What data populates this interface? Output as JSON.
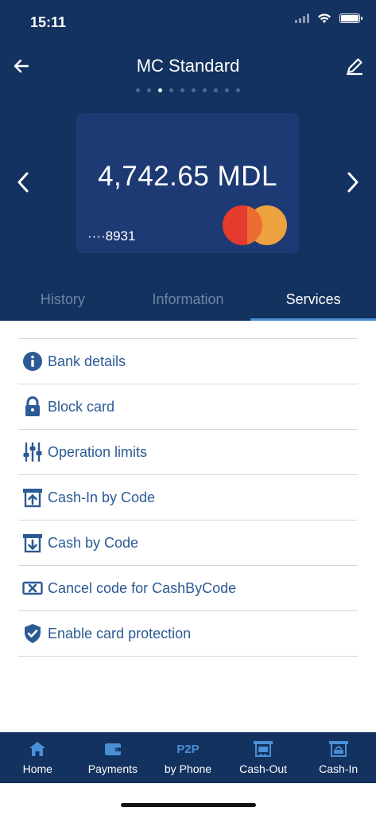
{
  "status": {
    "time": "15:11"
  },
  "header": {
    "title": "MC Standard"
  },
  "carousel": {
    "dot_count": 10,
    "active_index": 2
  },
  "card": {
    "balance": "4,742.65 MDL",
    "number": "····8931",
    "brand": "mastercard"
  },
  "tabs": [
    {
      "label": "History",
      "active": false
    },
    {
      "label": "Information",
      "active": false
    },
    {
      "label": "Services",
      "active": true
    }
  ],
  "services": [
    {
      "label": "Bank details",
      "icon": "info-icon"
    },
    {
      "label": "Block card",
      "icon": "lock-icon"
    },
    {
      "label": "Operation limits",
      "icon": "sliders-icon"
    },
    {
      "label": "Cash-In by Code",
      "icon": "cash-in-icon"
    },
    {
      "label": "Cash by Code",
      "icon": "cash-out-icon"
    },
    {
      "label": "Cancel code for CashByCode",
      "icon": "cancel-code-icon"
    },
    {
      "label": "Enable card protection",
      "icon": "shield-check-icon"
    }
  ],
  "bottom_nav": [
    {
      "label": "Home",
      "icon": "home-icon"
    },
    {
      "label": "Payments",
      "icon": "wallet-icon"
    },
    {
      "label": "by Phone",
      "icon_text": "P2P"
    },
    {
      "label": "Cash-Out",
      "icon": "atm-out-icon"
    },
    {
      "label": "Cash-In",
      "icon": "atm-in-icon"
    }
  ],
  "colors": {
    "header_bg": "#13325f",
    "card_bg": "#1e3a74",
    "accent": "#2c5a95",
    "tab_indicator": "#4a8fd6"
  }
}
